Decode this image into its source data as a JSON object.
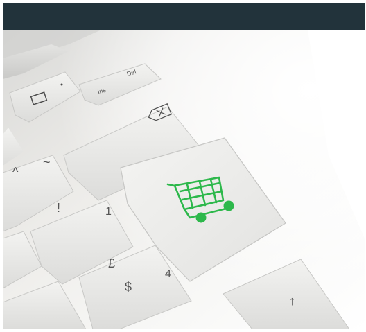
{
  "header": {
    "bar_color": "#22333b"
  },
  "photo": {
    "subject": "laptop-keyboard-with-shopping-cart-key",
    "cart_icon_color": "#2db84b",
    "key_labels": {
      "ins": "Ins",
      "del": "Del",
      "tilde": "~",
      "caret": "^",
      "exclaim": "!",
      "one": "1",
      "pound": "£",
      "dollar": "$",
      "four": "4",
      "up_arrow": "↑"
    }
  }
}
